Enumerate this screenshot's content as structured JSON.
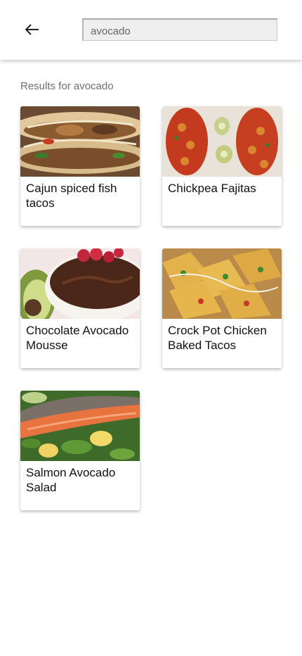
{
  "search": {
    "value": "avocado"
  },
  "results_label": "Results for avocado",
  "recipes": [
    {
      "title": "Cajun spiced fish tacos"
    },
    {
      "title": "Chickpea Fajitas"
    },
    {
      "title": "Chocolate Avocado Mousse"
    },
    {
      "title": "Crock Pot Chicken Baked Tacos"
    },
    {
      "title": "Salmon Avocado Salad"
    }
  ]
}
